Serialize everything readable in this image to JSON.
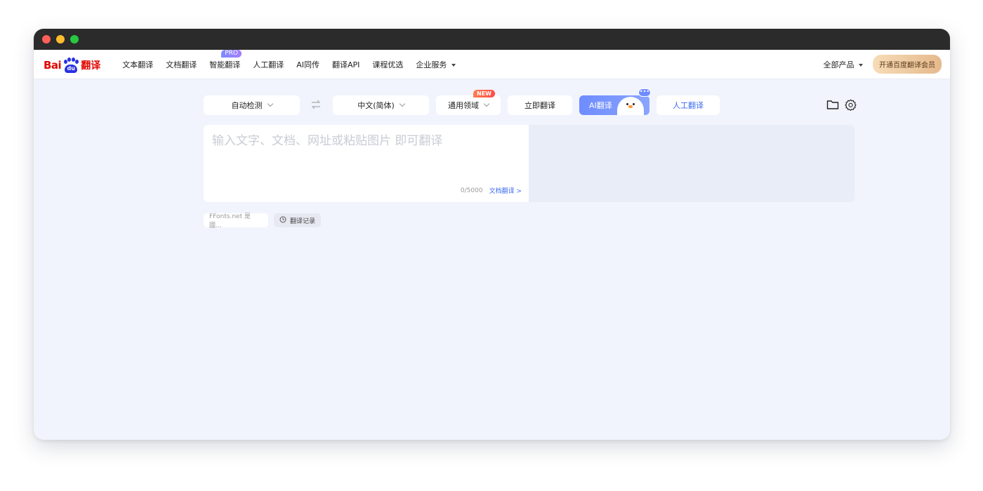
{
  "window": {
    "controls": [
      "close",
      "minimize",
      "zoom"
    ]
  },
  "logo": {
    "brand": "Bai",
    "paw_text": "du",
    "suffix": "翻译"
  },
  "nav": {
    "items": [
      {
        "label": "文本翻译"
      },
      {
        "label": "文档翻译"
      },
      {
        "label": "智能翻译",
        "badge": "PRO"
      },
      {
        "label": "人工翻译"
      },
      {
        "label": "AI同传"
      },
      {
        "label": "翻译API"
      },
      {
        "label": "课程优选"
      },
      {
        "label": "企业服务"
      }
    ],
    "all_products": "全部产品",
    "vip_button": "开通百度翻译会员"
  },
  "toolbar": {
    "source_lang": "自动检测",
    "target_lang": "中文(简体)",
    "domain": "通用领域",
    "domain_badge": "NEW",
    "translate_now": "立即翻译",
    "ai_translate": "AI翻译",
    "ai_bubble": "•••",
    "human_translate": "人工翻译"
  },
  "editor": {
    "placeholder": "输入文字、文档、网址或粘贴图片 即可翻译",
    "value": "",
    "char_count": "0/5000",
    "doc_link": "文档翻译 >"
  },
  "below": {
    "recent_chip": "FFonts.net 是國...",
    "history_button": "翻译记录"
  },
  "colors": {
    "brand_red": "#e10600",
    "brand_blue": "#2932e1",
    "accent_blue": "#3c6cf0",
    "page_bg": "#f1f4fc"
  }
}
